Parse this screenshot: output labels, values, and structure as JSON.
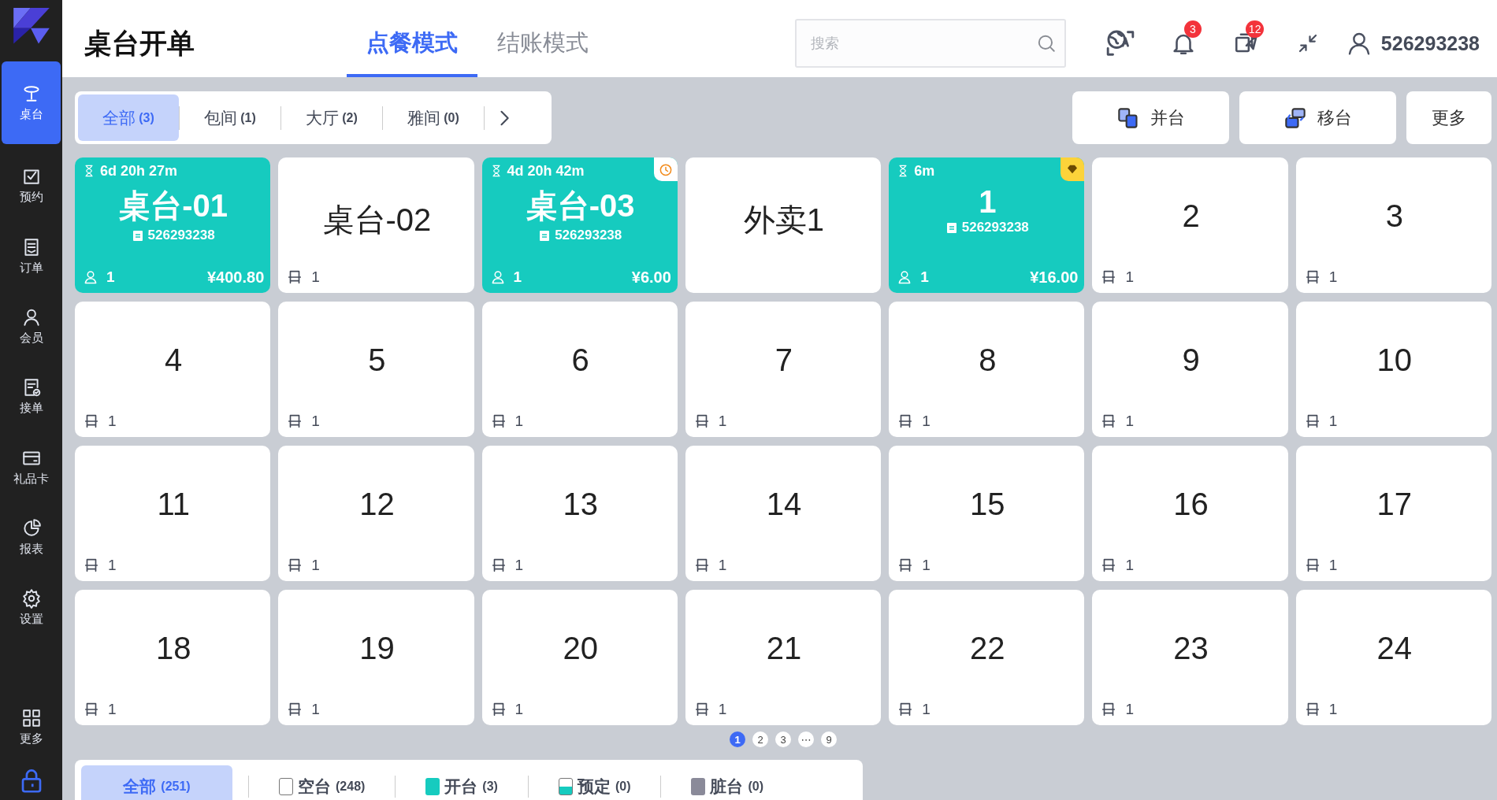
{
  "sidebar": {
    "items": [
      {
        "label": "桌台",
        "selected": true
      },
      {
        "label": "预约",
        "selected": false
      },
      {
        "label": "订单",
        "selected": false
      },
      {
        "label": "会员",
        "selected": false
      },
      {
        "label": "接单",
        "selected": false
      },
      {
        "label": "礼品卡",
        "selected": false
      },
      {
        "label": "报表",
        "selected": false
      },
      {
        "label": "设置",
        "selected": false
      },
      {
        "label": "更多",
        "selected": false
      }
    ]
  },
  "header": {
    "title": "桌台开单",
    "modes": [
      {
        "label": "点餐模式",
        "selected": true
      },
      {
        "label": "结账模式",
        "selected": false
      }
    ],
    "search": {
      "placeholder": "搜索"
    },
    "notifications": "3",
    "messages": "12",
    "user": "526293238"
  },
  "areas": [
    {
      "label": "全部",
      "count": "(3)",
      "selected": true
    },
    {
      "label": "包间",
      "count": "(1)",
      "selected": false
    },
    {
      "label": "大厅",
      "count": "(2)",
      "selected": false
    },
    {
      "label": "雅间",
      "count": "(0)",
      "selected": false
    }
  ],
  "actions": [
    {
      "label": "并台",
      "kind": "merge"
    },
    {
      "label": "移台",
      "kind": "move"
    },
    {
      "label": "更多",
      "kind": "plain"
    }
  ],
  "tables": [
    {
      "kind": "occupied",
      "name": "桌台-01",
      "timer": "6d 20h 27m",
      "member": "526293238",
      "guests": "1",
      "amount": "¥400.80"
    },
    {
      "kind": "empty",
      "name": "桌台-02",
      "seats": "1"
    },
    {
      "kind": "occupied",
      "name": "桌台-03",
      "timer": "4d 20h 42m",
      "member": "526293238",
      "guests": "1",
      "amount": "¥6.00",
      "badge": {
        "kind": "clock"
      }
    },
    {
      "kind": "empty",
      "name": "外卖1"
    },
    {
      "kind": "occupied",
      "name": "1",
      "timer": "6m",
      "member": "526293238",
      "guests": "1",
      "amount": "¥16.00",
      "badge": {
        "kind": "diamond"
      }
    },
    {
      "kind": "empty",
      "name": "2",
      "seats": "1"
    },
    {
      "kind": "empty",
      "name": "3",
      "seats": "1"
    },
    {
      "kind": "empty",
      "name": "4",
      "seats": "1"
    },
    {
      "kind": "empty",
      "name": "5",
      "seats": "1"
    },
    {
      "kind": "empty",
      "name": "6",
      "seats": "1"
    },
    {
      "kind": "empty",
      "name": "7",
      "seats": "1"
    },
    {
      "kind": "empty",
      "name": "8",
      "seats": "1"
    },
    {
      "kind": "empty",
      "name": "9",
      "seats": "1"
    },
    {
      "kind": "empty",
      "name": "10",
      "seats": "1"
    },
    {
      "kind": "empty",
      "name": "11",
      "seats": "1"
    },
    {
      "kind": "empty",
      "name": "12",
      "seats": "1"
    },
    {
      "kind": "empty",
      "name": "13",
      "seats": "1"
    },
    {
      "kind": "empty",
      "name": "14",
      "seats": "1"
    },
    {
      "kind": "empty",
      "name": "15",
      "seats": "1"
    },
    {
      "kind": "empty",
      "name": "16",
      "seats": "1"
    },
    {
      "kind": "empty",
      "name": "17",
      "seats": "1"
    },
    {
      "kind": "empty",
      "name": "18",
      "seats": "1"
    },
    {
      "kind": "empty",
      "name": "19",
      "seats": "1"
    },
    {
      "kind": "empty",
      "name": "20",
      "seats": "1"
    },
    {
      "kind": "empty",
      "name": "21",
      "seats": "1"
    },
    {
      "kind": "empty",
      "name": "22",
      "seats": "1"
    },
    {
      "kind": "empty",
      "name": "23",
      "seats": "1"
    },
    {
      "kind": "empty",
      "name": "24",
      "seats": "1"
    }
  ],
  "pagination": [
    {
      "label": "1",
      "selected": true
    },
    {
      "label": "2",
      "selected": false
    },
    {
      "label": "3",
      "selected": false
    },
    {
      "label": "⋯",
      "selected": false
    },
    {
      "label": "9",
      "selected": false
    }
  ],
  "legend": [
    {
      "label": "全部",
      "count": "(251)",
      "kind": "all",
      "selected": true
    },
    {
      "label": "空台",
      "count": "(248)",
      "kind": "free",
      "selected": false
    },
    {
      "label": "开台",
      "count": "(3)",
      "kind": "open",
      "selected": false
    },
    {
      "label": "预定",
      "count": "(0)",
      "kind": "reserved",
      "selected": false
    },
    {
      "label": "脏台",
      "count": "(0)",
      "kind": "dirty",
      "selected": false
    }
  ]
}
